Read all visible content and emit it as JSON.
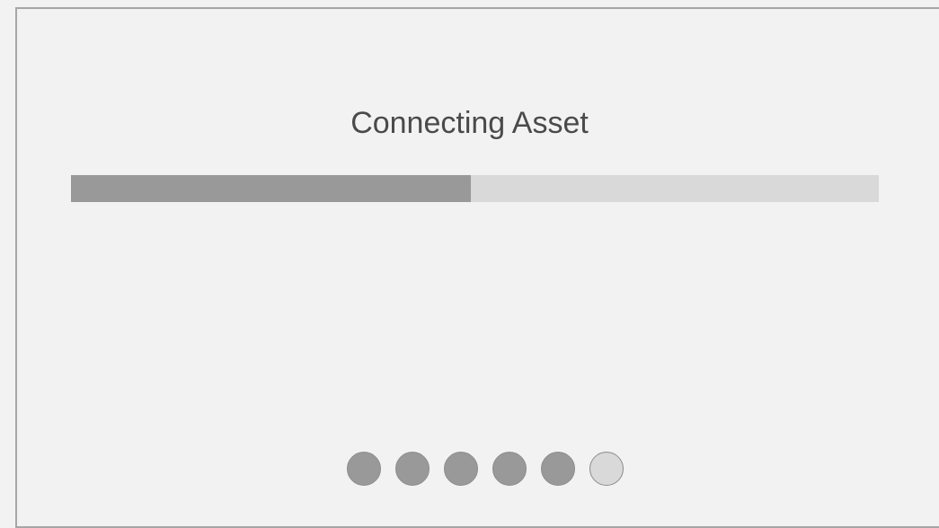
{
  "dialog": {
    "title": "Connecting Asset"
  },
  "progress": {
    "fraction": 0.495
  },
  "steps": {
    "total": 6,
    "completed": 5
  },
  "colors": {
    "background": "#f2f2f2",
    "progress_fill": "#999999",
    "progress_track": "#d9d9d9",
    "dot_active": "#999999",
    "dot_inactive": "#d9d9d9",
    "text": "#4a4a4a"
  }
}
